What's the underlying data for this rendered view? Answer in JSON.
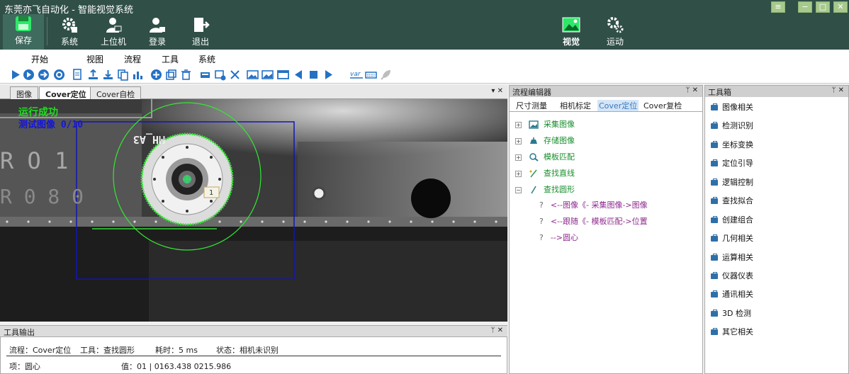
{
  "app": {
    "title": "东莞亦飞自动化 - 智能视觉系统",
    "window_controls": [
      "≡",
      "−",
      "□",
      "✕"
    ]
  },
  "main_toolbar": {
    "buttons": [
      {
        "label": "保存",
        "icon": "save-icon"
      },
      {
        "label": "系统",
        "icon": "system-gear-icon"
      },
      {
        "label": "上位机",
        "icon": "user-computer-icon"
      },
      {
        "label": "登录",
        "icon": "login-user-icon"
      },
      {
        "label": "退出",
        "icon": "exit-door-icon"
      }
    ],
    "right_buttons": [
      {
        "label": "视觉",
        "icon": "vision-image-icon"
      },
      {
        "label": "运动",
        "icon": "motion-gears-icon"
      }
    ]
  },
  "menu": [
    "开始",
    "视图",
    "流程",
    "工具",
    "系统"
  ],
  "left_panel": {
    "tabs": [
      "图像",
      "Cover定位",
      "Cover自检"
    ],
    "active_tab": 1,
    "controls": "▾ ✕",
    "overlay_status": "运行成功",
    "overlay_test": "测试图像 0/10",
    "image_label": "MH_A3",
    "marker_label": "1",
    "printed_left": "R O 1",
    "printed_left2": "R 0 8 0"
  },
  "tool_output": {
    "title": "工具输出",
    "controls": "ᛘ ✕",
    "flow_label": "流程：Cover定位",
    "tool_label": "工具：查找圆形",
    "time_label": "耗时：5 ms",
    "status_label": "状态：相机未识别",
    "item_label": "项：圆心",
    "value_label": "值：01 |  0163.438  0215.986"
  },
  "flow_editor": {
    "title": "流程编辑器",
    "controls": "ᛘ ✕",
    "tabs": [
      "尺寸测量",
      "相机标定",
      "Cover定位",
      "Cover复检"
    ],
    "active_tab": 2,
    "nodes": [
      {
        "expander": "+",
        "label": "采集图像",
        "icon": "capture-image-icon"
      },
      {
        "expander": "+",
        "label": "存储图像",
        "icon": "save-image-icon"
      },
      {
        "expander": "+",
        "label": "模板匹配",
        "icon": "template-match-icon"
      },
      {
        "expander": "+",
        "label": "查找直线",
        "icon": "find-line-icon"
      },
      {
        "expander": "−",
        "label": "查找圆形",
        "icon": "find-circle-icon"
      }
    ],
    "params": [
      {
        "q": "?",
        "label": "<--图像《- 采集图像->图像"
      },
      {
        "q": "?",
        "label": "<--跟随《- 模板匹配->位置"
      },
      {
        "q": "?",
        "label": "-->圆心"
      }
    ]
  },
  "toolbox": {
    "title": "工具箱",
    "controls": "ᛘ ✕",
    "items": [
      "图像相关",
      "检测识别",
      "坐标变换",
      "定位引导",
      "逻辑控制",
      "查找拟合",
      "创建组合",
      "几何相关",
      "运算相关",
      "仪器仪表",
      "通讯相关",
      "3D  检测",
      "其它相关"
    ]
  },
  "colors": {
    "titlebar": "#2f4f47",
    "toolbar_icon_blue": "#2471c4",
    "success_green": "#22dd22",
    "roi_blue": "#1515b8",
    "circle_green": "#33e833"
  }
}
